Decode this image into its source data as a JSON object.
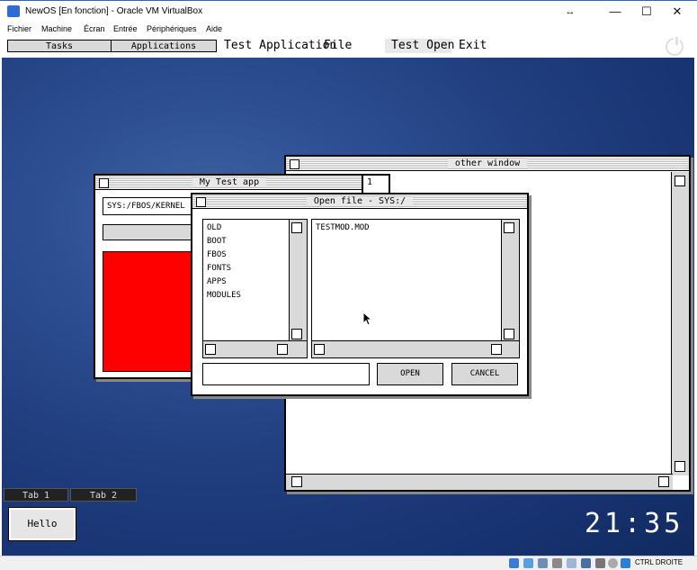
{
  "host": {
    "title": "NewOS [En fonction] - Oracle VM VirtualBox",
    "controls": {
      "restore": "↔",
      "minimize": "—",
      "maximize": "☐",
      "close": "✕"
    },
    "menu": [
      "Fichier",
      "Machine",
      "Écran",
      "Entrée",
      "Périphériques",
      "Aide"
    ],
    "status_text": "CTRL DROITE"
  },
  "guest": {
    "topbar": {
      "tasks": "Tasks",
      "applications": "Applications",
      "menu": [
        "Test Application",
        "File",
        "Test Open",
        "Exit"
      ]
    },
    "windows": {
      "other": {
        "title": "other window"
      },
      "mytest": {
        "title": "My Test app",
        "path": "SYS:/FBOS/KERNEL",
        "behind_tab": "1"
      },
      "open_file": {
        "title": "Open file - SYS:/",
        "folders": [
          "OLD",
          "BOOT",
          "FBOS",
          "FONTS",
          "APPS",
          "MODULES"
        ],
        "files": [
          "TESTMOD.MOD"
        ],
        "filename_value": "",
        "open_label": "OPEN",
        "cancel_label": "CANCEL"
      }
    },
    "tabs": [
      "Tab 1",
      "Tab 2"
    ],
    "hello_label": "Hello",
    "clock": "21:35"
  },
  "colors": {
    "desktop": "#1f3c7c",
    "red_panel": "#ff0000"
  }
}
